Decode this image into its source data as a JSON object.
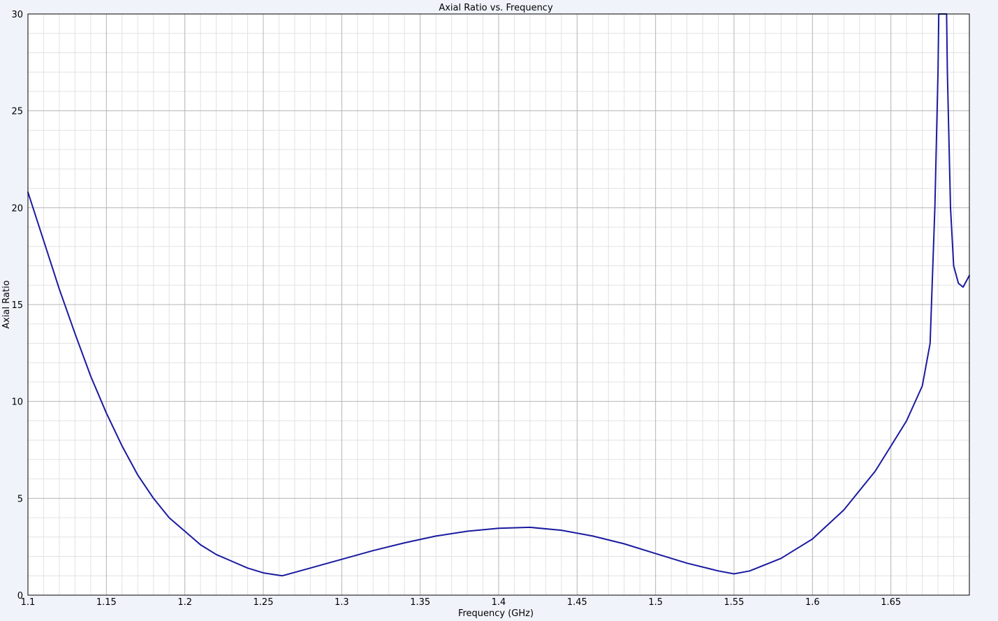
{
  "chart_data": {
    "type": "line",
    "title": "Axial Ratio vs. Frequency",
    "xlabel": "Frequency (GHz)",
    "ylabel": "Axial Ratio",
    "xlim": [
      1.1,
      1.7
    ],
    "ylim": [
      0,
      30
    ],
    "x_major_ticks": [
      1.1,
      1.15,
      1.2,
      1.25,
      1.3,
      1.35,
      1.4,
      1.45,
      1.5,
      1.55,
      1.6,
      1.65
    ],
    "x_tick_labels": [
      "1.1",
      "1.15",
      "1.2",
      "1.25",
      "1.3",
      "1.35",
      "1.4",
      "1.45",
      "1.5",
      "1.55",
      "1.6",
      "1.65"
    ],
    "y_major_ticks": [
      0,
      5,
      10,
      15,
      20,
      25,
      30
    ],
    "y_tick_labels": [
      "0",
      "5",
      "10",
      "15",
      "20",
      "25",
      "30"
    ],
    "grid": true,
    "legend": "none",
    "colors": {
      "line": "#1a1aa0",
      "major_grid": "#b4b4b4",
      "minor_grid": "#e2e2e2",
      "plot_bg": "#ffffff",
      "page_bg": "#f0f3fa"
    },
    "series": [
      {
        "x": [
          1.1,
          1.11,
          1.12,
          1.13,
          1.14,
          1.15,
          1.16,
          1.17,
          1.18,
          1.19,
          1.2,
          1.21,
          1.22,
          1.23,
          1.24,
          1.25,
          1.262,
          1.28,
          1.3,
          1.32,
          1.34,
          1.36,
          1.38,
          1.4,
          1.42,
          1.44,
          1.46,
          1.48,
          1.5,
          1.52,
          1.54,
          1.55,
          1.56,
          1.58,
          1.6,
          1.62,
          1.64,
          1.65,
          1.66,
          1.67,
          1.675,
          1.678,
          1.68,
          1.6805,
          1.681,
          1.685,
          1.6855,
          1.686,
          1.688,
          1.69,
          1.693,
          1.696,
          1.7
        ],
        "y": [
          20.8,
          18.3,
          15.8,
          13.5,
          11.3,
          9.4,
          7.7,
          6.2,
          5.0,
          4.0,
          3.3,
          2.6,
          2.1,
          1.75,
          1.4,
          1.15,
          1.0,
          1.4,
          1.85,
          2.3,
          2.7,
          3.05,
          3.3,
          3.45,
          3.5,
          3.35,
          3.05,
          2.65,
          2.15,
          1.65,
          1.25,
          1.1,
          1.25,
          1.9,
          2.9,
          4.4,
          6.4,
          7.7,
          9.0,
          10.8,
          13.0,
          20.0,
          27.0,
          30.0,
          30.0,
          30.0,
          30.0,
          27.0,
          20.0,
          17.0,
          16.1,
          15.9,
          16.5
        ]
      }
    ]
  }
}
